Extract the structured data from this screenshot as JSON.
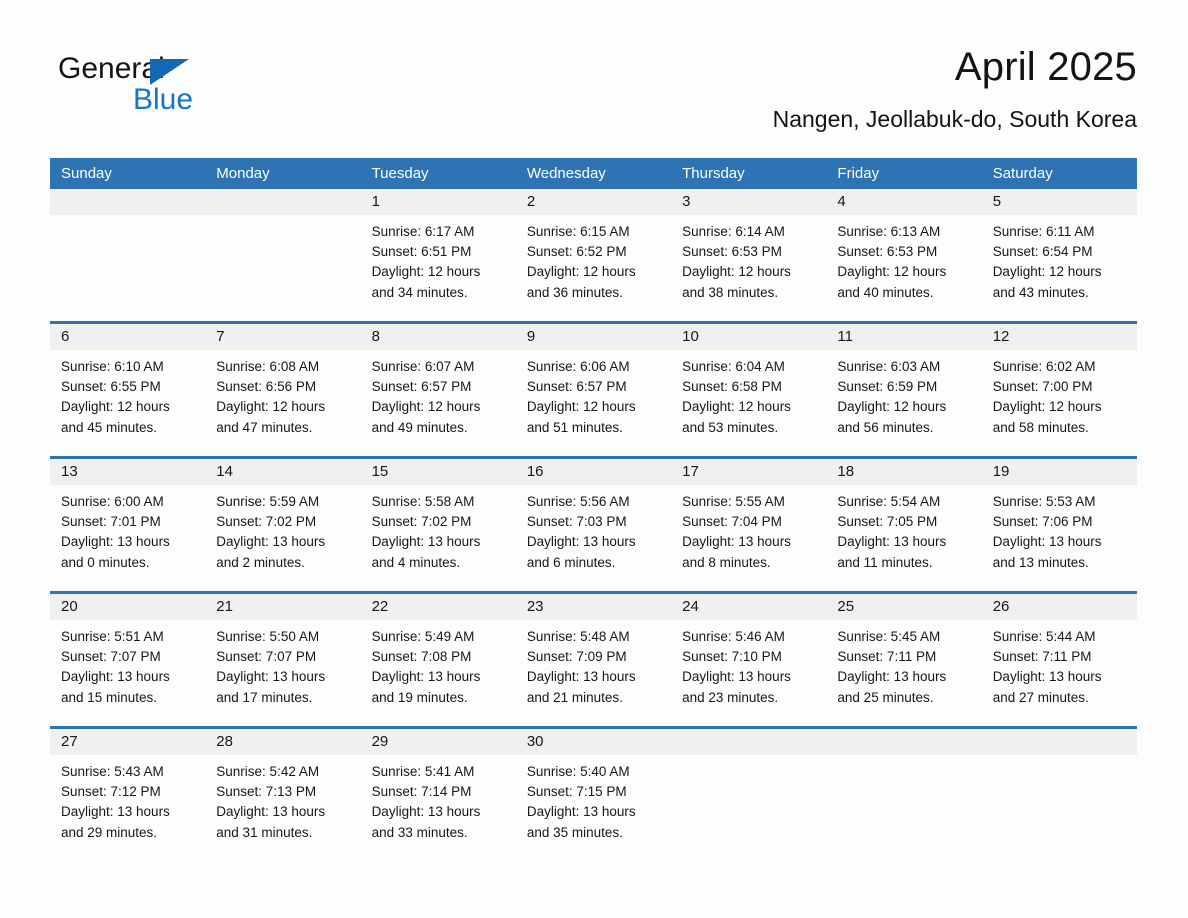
{
  "brand": {
    "name_part1": "General",
    "name_part2": "Blue",
    "flag_icon": "triangle-flag-icon",
    "accent_color": "#1668b3",
    "blue_text_color": "#1277c8"
  },
  "header": {
    "month_title": "April 2025",
    "location": "Nangen, Jeollabuk-do, South Korea"
  },
  "calendar": {
    "header_background": "#2e74b5",
    "day_band_background": "#f0f0f0",
    "weekdays": [
      "Sunday",
      "Monday",
      "Tuesday",
      "Wednesday",
      "Thursday",
      "Friday",
      "Saturday"
    ],
    "weeks": [
      [
        {
          "day": "",
          "sunrise": "",
          "sunset": "",
          "daylight_line1": "",
          "daylight_line2": "",
          "empty": true
        },
        {
          "day": "",
          "sunrise": "",
          "sunset": "",
          "daylight_line1": "",
          "daylight_line2": "",
          "empty": true
        },
        {
          "day": "1",
          "sunrise": "Sunrise: 6:17 AM",
          "sunset": "Sunset: 6:51 PM",
          "daylight_line1": "Daylight: 12 hours",
          "daylight_line2": "and 34 minutes.",
          "empty": false
        },
        {
          "day": "2",
          "sunrise": "Sunrise: 6:15 AM",
          "sunset": "Sunset: 6:52 PM",
          "daylight_line1": "Daylight: 12 hours",
          "daylight_line2": "and 36 minutes.",
          "empty": false
        },
        {
          "day": "3",
          "sunrise": "Sunrise: 6:14 AM",
          "sunset": "Sunset: 6:53 PM",
          "daylight_line1": "Daylight: 12 hours",
          "daylight_line2": "and 38 minutes.",
          "empty": false
        },
        {
          "day": "4",
          "sunrise": "Sunrise: 6:13 AM",
          "sunset": "Sunset: 6:53 PM",
          "daylight_line1": "Daylight: 12 hours",
          "daylight_line2": "and 40 minutes.",
          "empty": false
        },
        {
          "day": "5",
          "sunrise": "Sunrise: 6:11 AM",
          "sunset": "Sunset: 6:54 PM",
          "daylight_line1": "Daylight: 12 hours",
          "daylight_line2": "and 43 minutes.",
          "empty": false
        }
      ],
      [
        {
          "day": "6",
          "sunrise": "Sunrise: 6:10 AM",
          "sunset": "Sunset: 6:55 PM",
          "daylight_line1": "Daylight: 12 hours",
          "daylight_line2": "and 45 minutes.",
          "empty": false
        },
        {
          "day": "7",
          "sunrise": "Sunrise: 6:08 AM",
          "sunset": "Sunset: 6:56 PM",
          "daylight_line1": "Daylight: 12 hours",
          "daylight_line2": "and 47 minutes.",
          "empty": false
        },
        {
          "day": "8",
          "sunrise": "Sunrise: 6:07 AM",
          "sunset": "Sunset: 6:57 PM",
          "daylight_line1": "Daylight: 12 hours",
          "daylight_line2": "and 49 minutes.",
          "empty": false
        },
        {
          "day": "9",
          "sunrise": "Sunrise: 6:06 AM",
          "sunset": "Sunset: 6:57 PM",
          "daylight_line1": "Daylight: 12 hours",
          "daylight_line2": "and 51 minutes.",
          "empty": false
        },
        {
          "day": "10",
          "sunrise": "Sunrise: 6:04 AM",
          "sunset": "Sunset: 6:58 PM",
          "daylight_line1": "Daylight: 12 hours",
          "daylight_line2": "and 53 minutes.",
          "empty": false
        },
        {
          "day": "11",
          "sunrise": "Sunrise: 6:03 AM",
          "sunset": "Sunset: 6:59 PM",
          "daylight_line1": "Daylight: 12 hours",
          "daylight_line2": "and 56 minutes.",
          "empty": false
        },
        {
          "day": "12",
          "sunrise": "Sunrise: 6:02 AM",
          "sunset": "Sunset: 7:00 PM",
          "daylight_line1": "Daylight: 12 hours",
          "daylight_line2": "and 58 minutes.",
          "empty": false
        }
      ],
      [
        {
          "day": "13",
          "sunrise": "Sunrise: 6:00 AM",
          "sunset": "Sunset: 7:01 PM",
          "daylight_line1": "Daylight: 13 hours",
          "daylight_line2": "and 0 minutes.",
          "empty": false
        },
        {
          "day": "14",
          "sunrise": "Sunrise: 5:59 AM",
          "sunset": "Sunset: 7:02 PM",
          "daylight_line1": "Daylight: 13 hours",
          "daylight_line2": "and 2 minutes.",
          "empty": false
        },
        {
          "day": "15",
          "sunrise": "Sunrise: 5:58 AM",
          "sunset": "Sunset: 7:02 PM",
          "daylight_line1": "Daylight: 13 hours",
          "daylight_line2": "and 4 minutes.",
          "empty": false
        },
        {
          "day": "16",
          "sunrise": "Sunrise: 5:56 AM",
          "sunset": "Sunset: 7:03 PM",
          "daylight_line1": "Daylight: 13 hours",
          "daylight_line2": "and 6 minutes.",
          "empty": false
        },
        {
          "day": "17",
          "sunrise": "Sunrise: 5:55 AM",
          "sunset": "Sunset: 7:04 PM",
          "daylight_line1": "Daylight: 13 hours",
          "daylight_line2": "and 8 minutes.",
          "empty": false
        },
        {
          "day": "18",
          "sunrise": "Sunrise: 5:54 AM",
          "sunset": "Sunset: 7:05 PM",
          "daylight_line1": "Daylight: 13 hours",
          "daylight_line2": "and 11 minutes.",
          "empty": false
        },
        {
          "day": "19",
          "sunrise": "Sunrise: 5:53 AM",
          "sunset": "Sunset: 7:06 PM",
          "daylight_line1": "Daylight: 13 hours",
          "daylight_line2": "and 13 minutes.",
          "empty": false
        }
      ],
      [
        {
          "day": "20",
          "sunrise": "Sunrise: 5:51 AM",
          "sunset": "Sunset: 7:07 PM",
          "daylight_line1": "Daylight: 13 hours",
          "daylight_line2": "and 15 minutes.",
          "empty": false
        },
        {
          "day": "21",
          "sunrise": "Sunrise: 5:50 AM",
          "sunset": "Sunset: 7:07 PM",
          "daylight_line1": "Daylight: 13 hours",
          "daylight_line2": "and 17 minutes.",
          "empty": false
        },
        {
          "day": "22",
          "sunrise": "Sunrise: 5:49 AM",
          "sunset": "Sunset: 7:08 PM",
          "daylight_line1": "Daylight: 13 hours",
          "daylight_line2": "and 19 minutes.",
          "empty": false
        },
        {
          "day": "23",
          "sunrise": "Sunrise: 5:48 AM",
          "sunset": "Sunset: 7:09 PM",
          "daylight_line1": "Daylight: 13 hours",
          "daylight_line2": "and 21 minutes.",
          "empty": false
        },
        {
          "day": "24",
          "sunrise": "Sunrise: 5:46 AM",
          "sunset": "Sunset: 7:10 PM",
          "daylight_line1": "Daylight: 13 hours",
          "daylight_line2": "and 23 minutes.",
          "empty": false
        },
        {
          "day": "25",
          "sunrise": "Sunrise: 5:45 AM",
          "sunset": "Sunset: 7:11 PM",
          "daylight_line1": "Daylight: 13 hours",
          "daylight_line2": "and 25 minutes.",
          "empty": false
        },
        {
          "day": "26",
          "sunrise": "Sunrise: 5:44 AM",
          "sunset": "Sunset: 7:11 PM",
          "daylight_line1": "Daylight: 13 hours",
          "daylight_line2": "and 27 minutes.",
          "empty": false
        }
      ],
      [
        {
          "day": "27",
          "sunrise": "Sunrise: 5:43 AM",
          "sunset": "Sunset: 7:12 PM",
          "daylight_line1": "Daylight: 13 hours",
          "daylight_line2": "and 29 minutes.",
          "empty": false
        },
        {
          "day": "28",
          "sunrise": "Sunrise: 5:42 AM",
          "sunset": "Sunset: 7:13 PM",
          "daylight_line1": "Daylight: 13 hours",
          "daylight_line2": "and 31 minutes.",
          "empty": false
        },
        {
          "day": "29",
          "sunrise": "Sunrise: 5:41 AM",
          "sunset": "Sunset: 7:14 PM",
          "daylight_line1": "Daylight: 13 hours",
          "daylight_line2": "and 33 minutes.",
          "empty": false
        },
        {
          "day": "30",
          "sunrise": "Sunrise: 5:40 AM",
          "sunset": "Sunset: 7:15 PM",
          "daylight_line1": "Daylight: 13 hours",
          "daylight_line2": "and 35 minutes.",
          "empty": false
        },
        {
          "day": "",
          "sunrise": "",
          "sunset": "",
          "daylight_line1": "",
          "daylight_line2": "",
          "empty": true
        },
        {
          "day": "",
          "sunrise": "",
          "sunset": "",
          "daylight_line1": "",
          "daylight_line2": "",
          "empty": true
        },
        {
          "day": "",
          "sunrise": "",
          "sunset": "",
          "daylight_line1": "",
          "daylight_line2": "",
          "empty": true
        }
      ]
    ]
  }
}
